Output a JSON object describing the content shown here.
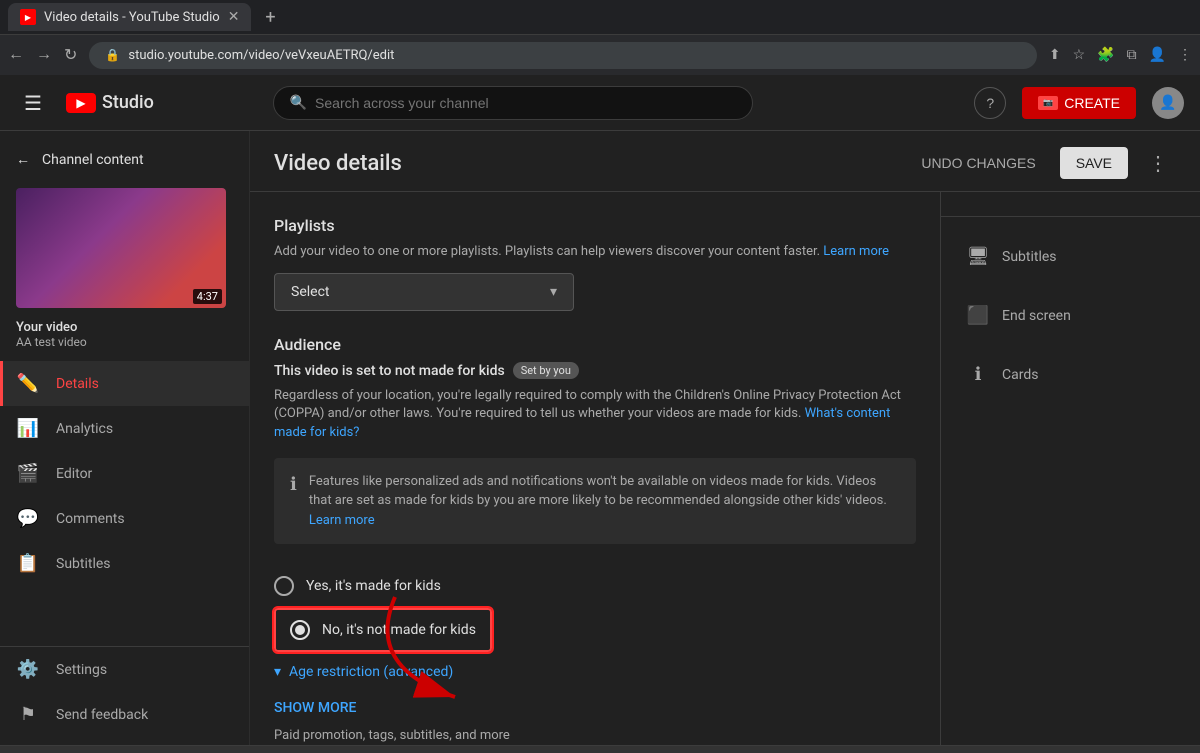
{
  "browser": {
    "tab_title": "Video details - YouTube Studio",
    "url": "studio.youtube.com/video/veVxeuAETRQ/edit",
    "new_tab_label": "+"
  },
  "nav": {
    "search_placeholder": "Search across your channel",
    "create_label": "CREATE",
    "hamburger_icon": "☰",
    "help_icon": "?",
    "logo_text": "Studio"
  },
  "sidebar": {
    "back_label": "Channel content",
    "video_title": "Your video",
    "video_subtitle": "AA test video",
    "video_duration": "4:37",
    "nav_items": [
      {
        "id": "details",
        "label": "Details",
        "icon": "✏️",
        "active": true
      },
      {
        "id": "analytics",
        "label": "Analytics",
        "icon": "📊",
        "active": false
      },
      {
        "id": "editor",
        "label": "Editor",
        "icon": "🎬",
        "active": false
      },
      {
        "id": "comments",
        "label": "Comments",
        "icon": "💬",
        "active": false
      },
      {
        "id": "subtitles",
        "label": "Subtitles",
        "icon": "📋",
        "active": false
      }
    ],
    "bottom_items": [
      {
        "id": "settings",
        "label": "Settings",
        "icon": "⚙️"
      },
      {
        "id": "send-feedback",
        "label": "Send feedback",
        "icon": "⚑"
      }
    ]
  },
  "page": {
    "title": "Video details",
    "undo_label": "UNDO CHANGES",
    "save_label": "SAVE"
  },
  "form": {
    "playlists_section": "Playlists",
    "playlists_desc": "Add your video to one or more playlists. Playlists can help viewers discover your content faster.",
    "playlists_learn_more": "Learn more",
    "playlist_select": "Select",
    "audience_title": "Audience",
    "audience_status": "This video is set to not made for kids",
    "set_by_badge": "Set by you",
    "audience_desc1": "Regardless of your location, you're legally required to comply with the Children's Online Privacy Protection Act (COPPA) and/or other laws. You're required to tell us whether your videos are made for kids.",
    "what_content_link": "What's content made for kids?",
    "info_text": "Features like personalized ads and notifications won't be available on videos made for kids. Videos that are set as made for kids by you are more likely to be recommended alongside other kids' videos.",
    "info_learn_more": "Learn more",
    "radio_yes": "Yes, it's made for kids",
    "radio_no": "No, it's not made for kids",
    "age_restriction": "Age restriction (advanced)",
    "show_more": "SHOW MORE",
    "promo_text": "Paid promotion, tags, subtitles, and more"
  },
  "right_panel": {
    "items": [
      {
        "id": "subtitles",
        "label": "Subtitles",
        "icon": "🖥"
      },
      {
        "id": "end-screen",
        "label": "End screen",
        "icon": "⬛"
      },
      {
        "id": "cards",
        "label": "Cards",
        "icon": "ℹ"
      }
    ]
  }
}
